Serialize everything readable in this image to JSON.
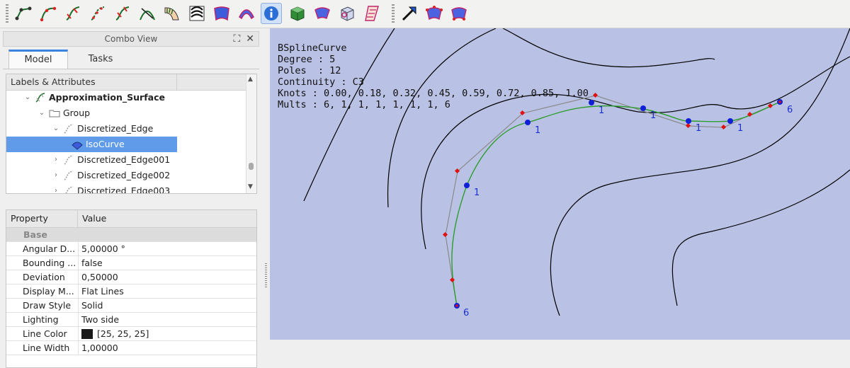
{
  "toolbar": {
    "tools": [
      {
        "icon": "polyline-curve-icon"
      },
      {
        "icon": "interpolate-curve-icon"
      },
      {
        "icon": "approximate-curve-icon"
      },
      {
        "icon": "discretize-curve-icon"
      },
      {
        "icon": "segment-curve-icon"
      },
      {
        "icon": "trim-curve-icon"
      },
      {
        "icon": "sweep-surface-icon"
      },
      {
        "icon": "zebra-shading-icon"
      },
      {
        "icon": "nurbs-surface-icon"
      },
      {
        "icon": "iso-curve-surface-icon"
      },
      {
        "icon": "info-icon",
        "active": true
      },
      {
        "icon": "solid-box-icon"
      },
      {
        "icon": "surface-patch-icon"
      },
      {
        "icon": "face-cube-icon"
      },
      {
        "icon": "ruled-surface-icon"
      },
      {
        "icon": "pointer-arrow-icon"
      },
      {
        "icon": "surface-control-points-icon"
      },
      {
        "icon": "surface-knots-icon"
      }
    ]
  },
  "combo": {
    "title": "Combo View",
    "tabs": [
      "Model",
      "Tasks"
    ]
  },
  "tree": {
    "header": "Labels & Attributes",
    "items": [
      {
        "label": "Approximation_Surface",
        "bold": true
      },
      {
        "label": "Group"
      },
      {
        "label": "Discretized_Edge"
      },
      {
        "label": "IsoCurve",
        "selected": true
      },
      {
        "label": "Discretized_Edge001"
      },
      {
        "label": "Discretized_Edge002"
      },
      {
        "label": "Discretized_Edge003"
      }
    ]
  },
  "properties": {
    "col_property": "Property",
    "col_value": "Value",
    "group": "Base",
    "rows": [
      {
        "name": "Angular D...",
        "value": "5,00000 °"
      },
      {
        "name": "Bounding ...",
        "value": "false"
      },
      {
        "name": "Deviation",
        "value": "0,50000"
      },
      {
        "name": "Display M...",
        "value": "Flat Lines"
      },
      {
        "name": "Draw Style",
        "value": "Solid"
      },
      {
        "name": "Lighting",
        "value": "Two side"
      },
      {
        "name": "Line Color",
        "value": "[25, 25, 25]",
        "swatch": "#191919"
      },
      {
        "name": "Line Width",
        "value": "1,00000"
      }
    ]
  },
  "view": {
    "background": "#b9c1e4",
    "info_lines": [
      "BSplineCurve",
      "Degree : 5",
      "Poles  : 12",
      "Continuity : C3",
      "Knots : 0.00, 0.18, 0.32, 0.45, 0.59, 0.72, 0.85, 1.00",
      "Mults : 6, 1, 1, 1, 1, 1, 1, 6"
    ],
    "knot_labels": [
      "6",
      "1",
      "1",
      "1",
      "1",
      "1",
      "1",
      "6"
    ]
  }
}
